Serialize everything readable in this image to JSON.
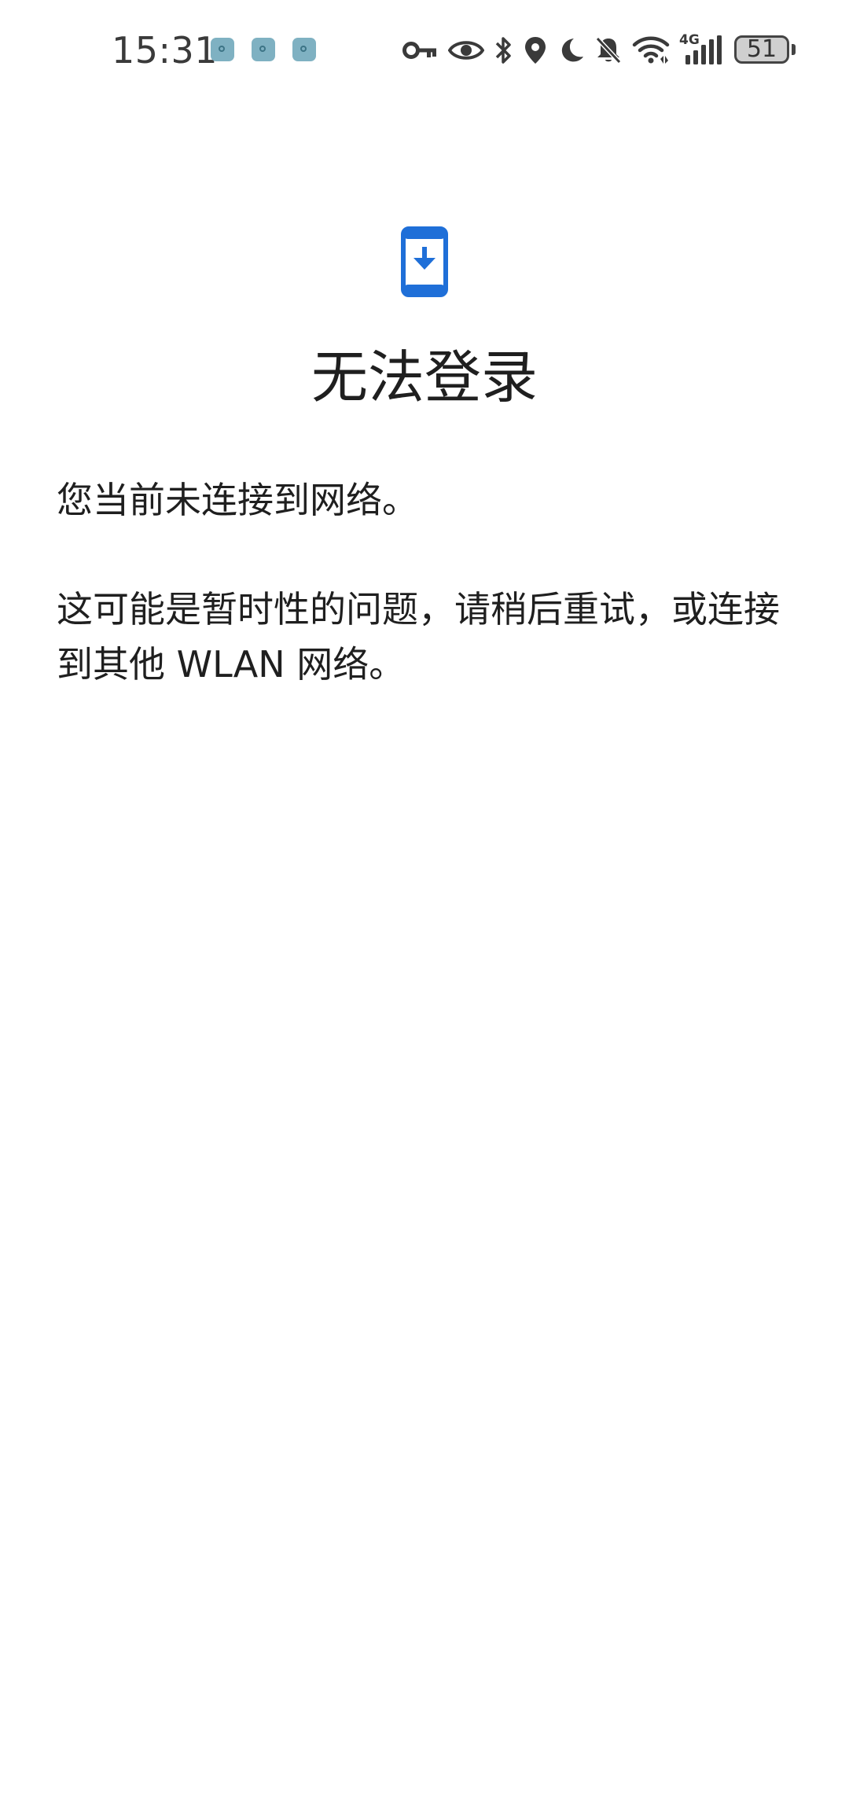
{
  "status_bar": {
    "time": "15:31",
    "notification_icons": [
      "app-notification-icon",
      "app-notification-icon",
      "app-notification-icon"
    ],
    "system_icons": [
      "vpn-key-icon",
      "eye-icon",
      "bluetooth-icon",
      "location-icon",
      "do-not-disturb-moon-icon",
      "mute-bell-icon",
      "wifi-icon",
      "cellular-4g-signal-icon"
    ],
    "network_type": "4G",
    "battery_level": "51"
  },
  "screen": {
    "icon": "phone-download-icon",
    "title": "无法登录",
    "message_line_1": "您当前未连接到网络。",
    "message_line_2": "这可能是暂时性的问题，请稍后重试，或连接到其他 WLAN 网络。"
  },
  "colors": {
    "accent": "#1f6fd8",
    "text": "#1f1f1f",
    "status_text": "#3a3a3a",
    "background": "#ffffff"
  }
}
